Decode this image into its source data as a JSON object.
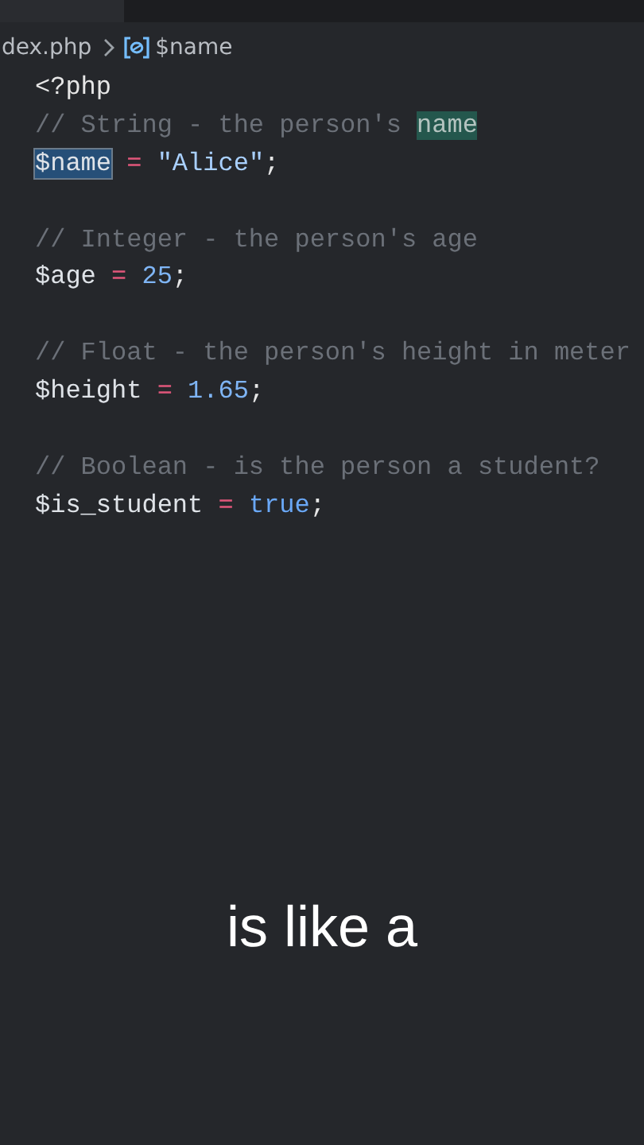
{
  "breadcrumb": {
    "file": "dex.php",
    "symbol": "$name"
  },
  "code": [
    {
      "kind": "code",
      "tokens": [
        {
          "text": "<?php",
          "kind": "tag",
          "selected": false,
          "match": false
        }
      ]
    },
    {
      "kind": "code",
      "tokens": [
        {
          "text": "// String - the person's ",
          "kind": "comment",
          "selected": false,
          "match": false
        },
        {
          "text": "name",
          "kind": "comment",
          "selected": false,
          "match": true
        }
      ]
    },
    {
      "kind": "code",
      "tokens": [
        {
          "text": "$name",
          "kind": "variable",
          "selected": true,
          "match": false
        },
        {
          "text": " = ",
          "kind": "operator",
          "selected": false,
          "match": false
        },
        {
          "text": "\"Alice\"",
          "kind": "string",
          "selected": false,
          "match": false
        },
        {
          "text": ";",
          "kind": "punct",
          "selected": false,
          "match": false
        }
      ]
    },
    {
      "kind": "blank"
    },
    {
      "kind": "code",
      "tokens": [
        {
          "text": "// Integer - the person's age",
          "kind": "comment",
          "selected": false,
          "match": false
        }
      ]
    },
    {
      "kind": "code",
      "tokens": [
        {
          "text": "$age",
          "kind": "variable",
          "selected": false,
          "match": false
        },
        {
          "text": " = ",
          "kind": "operator",
          "selected": false,
          "match": false
        },
        {
          "text": "25",
          "kind": "number",
          "selected": false,
          "match": false
        },
        {
          "text": ";",
          "kind": "punct",
          "selected": false,
          "match": false
        }
      ]
    },
    {
      "kind": "blank"
    },
    {
      "kind": "code",
      "tokens": [
        {
          "text": "// Float - the person's height in meter",
          "kind": "comment",
          "selected": false,
          "match": false
        }
      ]
    },
    {
      "kind": "code",
      "tokens": [
        {
          "text": "$height",
          "kind": "variable",
          "selected": false,
          "match": false
        },
        {
          "text": " = ",
          "kind": "operator",
          "selected": false,
          "match": false
        },
        {
          "text": "1.65",
          "kind": "number",
          "selected": false,
          "match": false
        },
        {
          "text": ";",
          "kind": "punct",
          "selected": false,
          "match": false
        }
      ]
    },
    {
      "kind": "blank"
    },
    {
      "kind": "code",
      "tokens": [
        {
          "text": "// Boolean - is the person a student?",
          "kind": "comment",
          "selected": false,
          "match": false
        }
      ]
    },
    {
      "kind": "code",
      "tokens": [
        {
          "text": "$is_student",
          "kind": "variable",
          "selected": false,
          "match": false
        },
        {
          "text": " = ",
          "kind": "operator",
          "selected": false,
          "match": false
        },
        {
          "text": "true",
          "kind": "keyword",
          "selected": false,
          "match": false
        },
        {
          "text": ";",
          "kind": "punct",
          "selected": false,
          "match": false
        }
      ]
    }
  ],
  "caption": "is like a"
}
